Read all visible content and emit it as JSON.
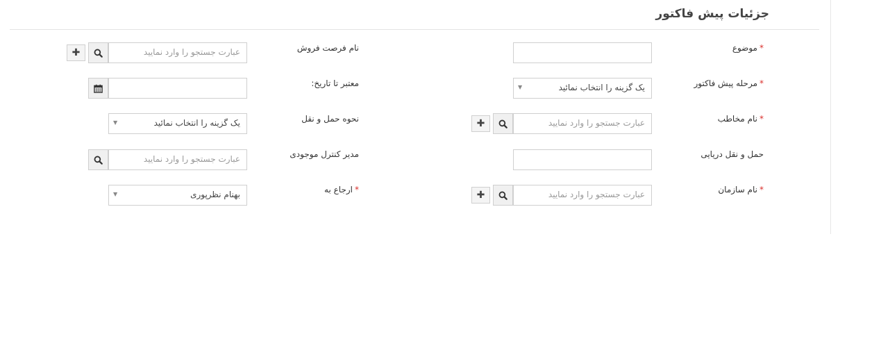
{
  "header": {
    "title": "جزئیات پیش فاکتور"
  },
  "form": {
    "required_mark": "*",
    "search_placeholder": "عبارت جستجو را وارد نمایید",
    "select_placeholder": "یک گزینه را انتخاب نمائید",
    "plus_glyph": "✚",
    "right_col": {
      "subject_label": "موضوع",
      "stage_label": "مرحله پیش فاکتور",
      "contact_label": "نام مخاطب",
      "shipping_sea_label": "حمل و نقل دریایی",
      "organization_label": "نام سازمان"
    },
    "left_col": {
      "opportunity_label": "نام فرصت فروش",
      "valid_until_label": "معتبر تا تاریخ:",
      "shipping_method_label": "نحوه حمل و نقل",
      "inventory_manager_label": "مدیر کنترل موجودی",
      "assigned_to_label": "ارجاع به",
      "assigned_to_value": "بهنام نظرپوری"
    }
  }
}
